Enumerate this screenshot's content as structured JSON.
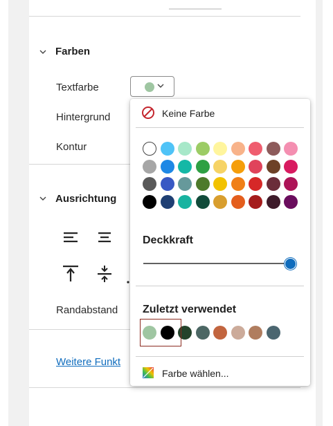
{
  "colors": {
    "accent": "#0f6cbd",
    "link": "#0f6cbd",
    "selected_outline": "#8b2a1f",
    "current_text_color": "#9fc6a2"
  },
  "farben": {
    "title": "Farben",
    "textfarbe": "Textfarbe",
    "hintergrund": "Hintergrund",
    "kontur": "Kontur"
  },
  "ausrichtung": {
    "title": "Ausrichtung",
    "randabstand": "Randabstand"
  },
  "more_link": "Weitere Funkt",
  "popup": {
    "no_color": "Keine Farbe",
    "opacity_label": "Deckkraft",
    "opacity_value": 1.0,
    "recent_label": "Zuletzt verwendet",
    "choose_color": "Farbe wählen...",
    "palette": [
      [
        "#ffffff",
        "#4fc3f7",
        "#a7e8c9",
        "#9ccc65",
        "#fff59d",
        "#f8b38a",
        "#ef5d6f",
        "#8d5b5b",
        "#f48fb1"
      ],
      [
        "#a6a6a6",
        "#1e88e5",
        "#14b8a6",
        "#2ea043",
        "#f6d365",
        "#f59e0b",
        "#e0435b",
        "#6d4127",
        "#d81b60"
      ],
      [
        "#595959",
        "#3858c4",
        "#66999b",
        "#4d7a2b",
        "#f2c200",
        "#f07f17",
        "#d62828",
        "#6b2d3a",
        "#ad1457"
      ],
      [
        "#000000",
        "#1f3f73",
        "#18b3a0",
        "#114b3a",
        "#d89e2e",
        "#e45e1d",
        "#a51c1c",
        "#3e1b2a",
        "#6a0d5d"
      ]
    ],
    "recent_colors": [
      "#9fc6a2",
      "#000000",
      "#24432b",
      "#4c6764",
      "#c2653f",
      "#ccab9a",
      "#b07d5f",
      "#4b6670"
    ]
  }
}
